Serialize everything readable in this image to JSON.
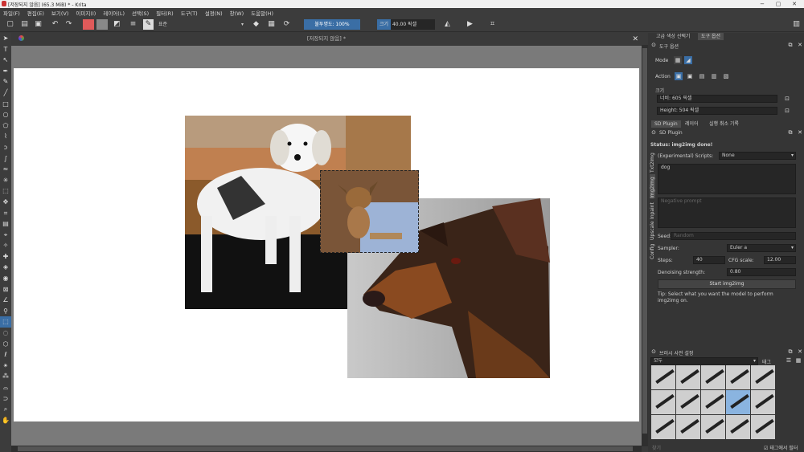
{
  "window": {
    "title": "[저장되지 않음] (65.3 MiB) * - Krita",
    "controls": [
      "−",
      "▢",
      "✕"
    ]
  },
  "menu": [
    "파일(F)",
    "편집(E)",
    "보기(V)",
    "이미지(I)",
    "레이어(L)",
    "선택(S)",
    "필터(R)",
    "도구(T)",
    "설정(N)",
    "창(W)",
    "도움말(H)"
  ],
  "toolbar": {
    "blend_mode": "표준",
    "opacity_label": "불투명도: 100%",
    "size_label": "크기",
    "size_value": "40.00 픽셀",
    "fg_color": "#e05a5a",
    "bg_color": "#888888"
  },
  "document": {
    "tab_title": "[저장되지 않음] *"
  },
  "tool_options": {
    "tabs": [
      "고급 색상 선택기",
      "도구 옵션"
    ],
    "panel_title": "도구 옵션",
    "mode_label": "Mode",
    "action_label": "Action",
    "size_section": "크기",
    "width": "너비: 605 픽셀",
    "height": "Height: 504 픽셀"
  },
  "sd_plugin": {
    "tabs": [
      "SD Plugin",
      "레이어",
      "실행 취소 기록"
    ],
    "panel_title": "SD Plugin",
    "side_tabs": [
      "Txt2Img",
      "Img2Img",
      "Inpaint",
      "Upscale",
      "Config"
    ],
    "status": "Status: img2img done!",
    "scripts_label": "(Experimental) Scripts:",
    "scripts_value": "None",
    "prompt": "dog",
    "negative_placeholder": "Negative prompt",
    "seed_label": "Seed:",
    "seed_placeholder": "Random",
    "sampler_label": "Sampler:",
    "sampler_value": "Euler a",
    "steps_label": "Steps:",
    "steps_value": "40",
    "cfg_label": "CFG scale:",
    "cfg_value": "12.00",
    "denoise_label": "Denoising strength:",
    "denoise_value": "0.80",
    "start_button": "Start img2img",
    "tip": "Tip: Select what you want the model to perform img2img on."
  },
  "brush_presets": {
    "panel_title": "브러시 사전 설정",
    "filter": "모두",
    "tag_label": "태그",
    "search_placeholder": "찾기",
    "filter_tag_label": "태그에서 필터"
  }
}
